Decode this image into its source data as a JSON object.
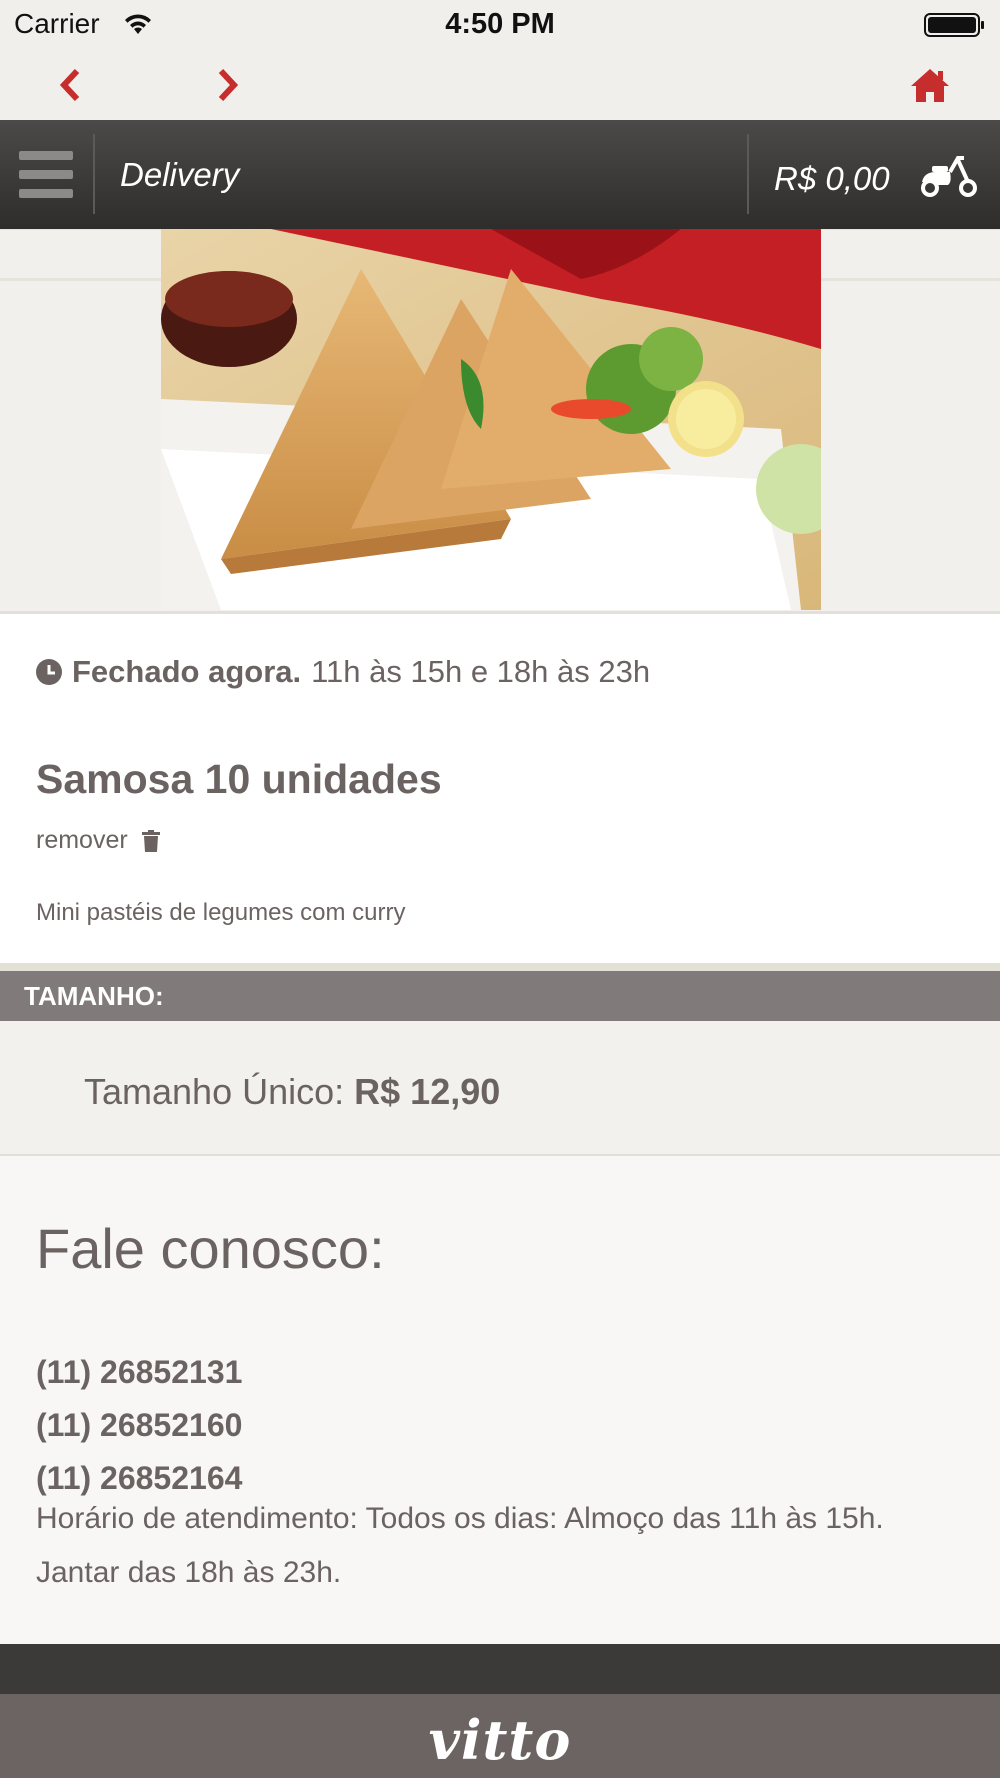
{
  "status_bar": {
    "carrier": "Carrier",
    "time": "4:50 PM"
  },
  "nav": {
    "back_icon": "chevron-left-icon",
    "forward_icon": "chevron-right-icon",
    "home_icon": "home-icon",
    "accent_color": "#c62e2e"
  },
  "header": {
    "title": "Delivery",
    "cart_total": "R$ 0,00",
    "menu_icon": "hamburger-icon",
    "cart_icon": "scooter-icon"
  },
  "product": {
    "image_icon": "samosa-photo",
    "status_closed": "Fechado agora.",
    "status_hours": "11h às 15h e 18h às 23h",
    "name": "Samosa 10 unidades",
    "remove_label": "remover",
    "description": "Mini pastéis de legumes com curry"
  },
  "size": {
    "header": "TAMANHO:",
    "option_label": "Tamanho Único:",
    "option_price": "R$ 12,90"
  },
  "contact": {
    "title": "Fale conosco:",
    "phones": [
      "(11) 26852131",
      "(11) 26852160",
      "(11) 26852164"
    ],
    "hours": "Horário de atendimento: Todos os dias: Almoço das 11h às 15h. Jantar das 18h às 23h."
  },
  "footer": {
    "logo": "vitto"
  }
}
